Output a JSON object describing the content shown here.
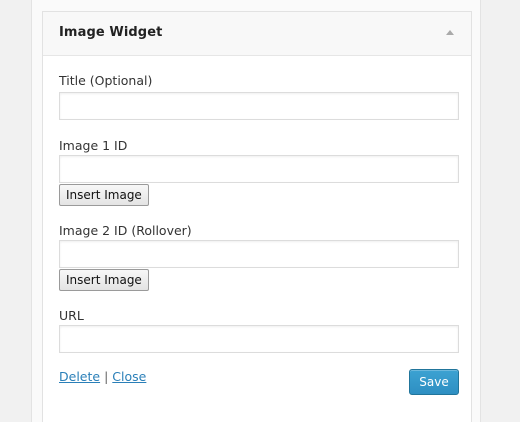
{
  "widget": {
    "title": "Image Widget",
    "toggle_icon": "triangle-up-icon"
  },
  "fields": {
    "title": {
      "label": "Title (Optional)",
      "value": "",
      "placeholder": ""
    },
    "image1": {
      "label": "Image 1 ID",
      "value": "",
      "placeholder": "",
      "button_label": "Insert Image"
    },
    "image2": {
      "label": "Image 2 ID (Rollover)",
      "value": "",
      "placeholder": "",
      "button_label": "Insert Image"
    },
    "url": {
      "label": "URL",
      "value": "",
      "placeholder": ""
    }
  },
  "footer": {
    "delete_label": "Delete",
    "separator": "|",
    "close_label": "Close",
    "save_label": "Save"
  },
  "colors": {
    "link": "#2a7fb8",
    "save_button": "#2e8fc2"
  }
}
